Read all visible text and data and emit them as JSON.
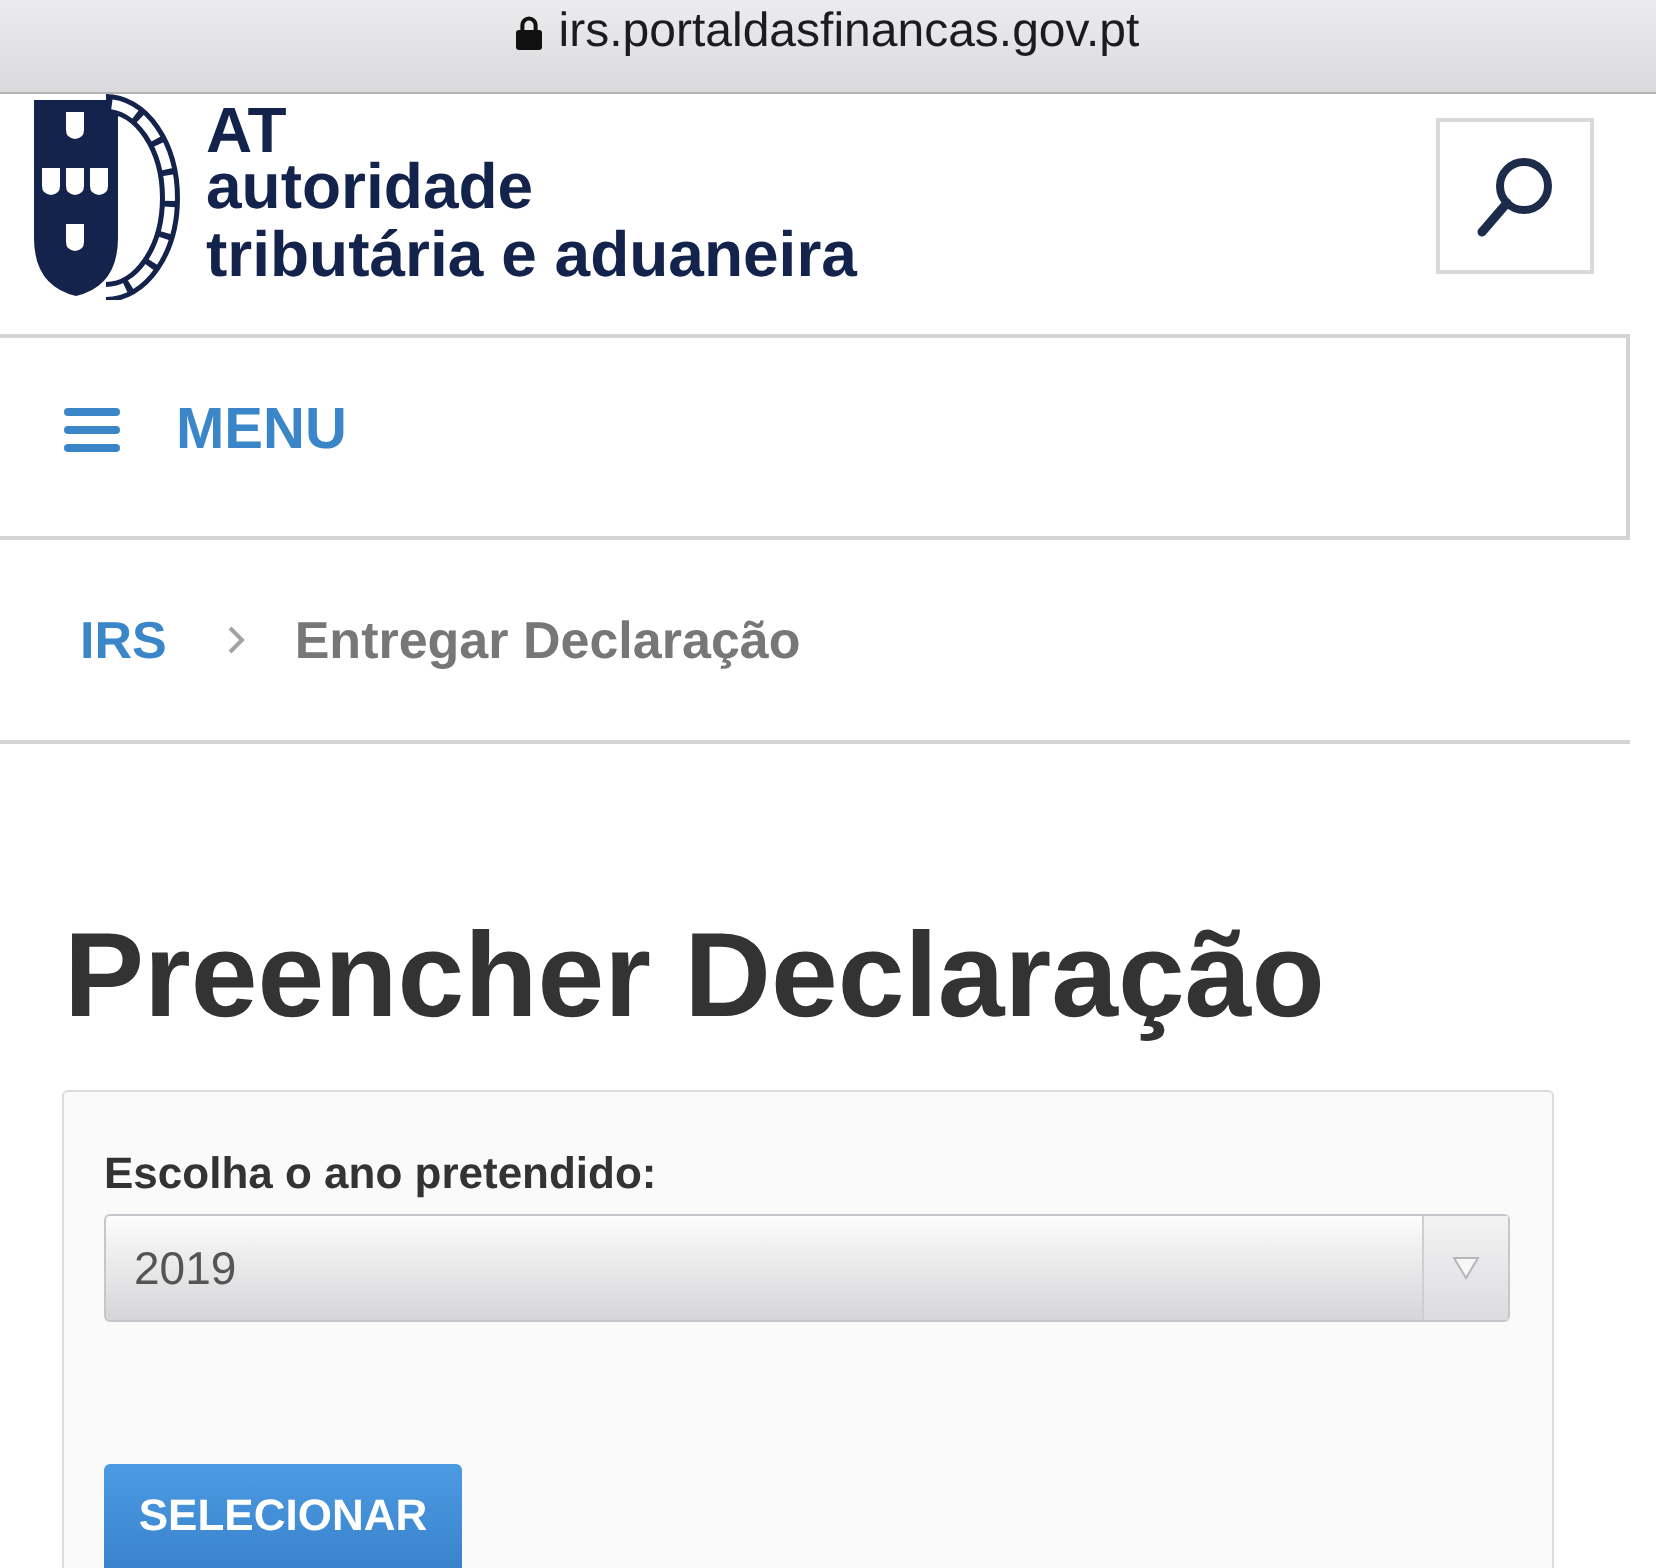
{
  "browser": {
    "url": "irs.portaldasfinancas.gov.pt"
  },
  "header": {
    "logo": {
      "abbreviation": "AT",
      "lines": [
        "autoridade",
        "tributária e aduaneira"
      ]
    }
  },
  "menu": {
    "label": "MENU"
  },
  "breadcrumb": [
    {
      "label": "IRS",
      "kind": "link"
    },
    {
      "label": "Entregar Declaração",
      "kind": "current"
    }
  ],
  "title": "Preencher Declaração",
  "form": {
    "label": "Escolha o ano pretendido:",
    "year_select": {
      "value": "2019"
    },
    "submit": "SELECIONAR"
  }
}
